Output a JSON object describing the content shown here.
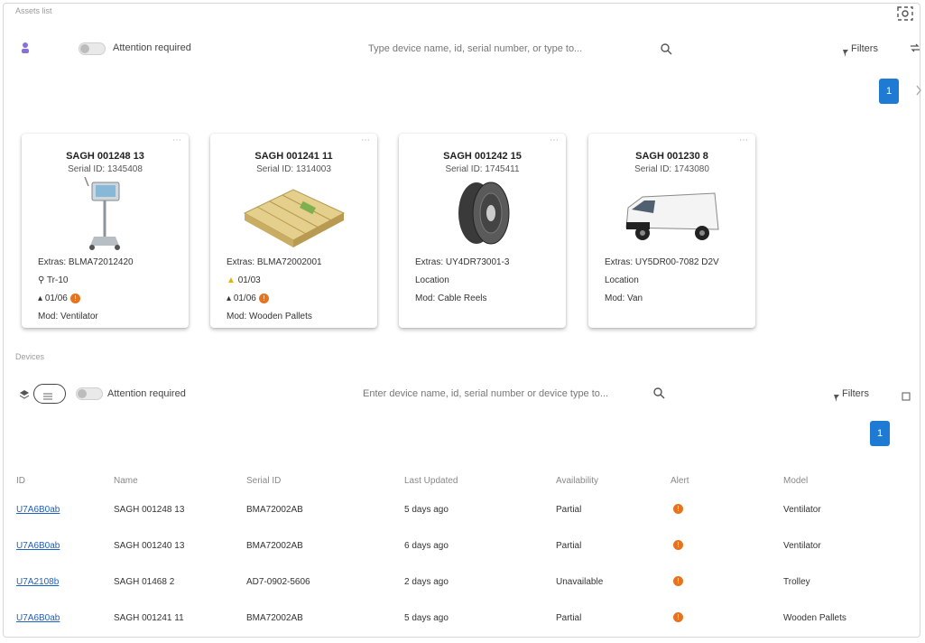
{
  "top": {
    "section_label": "Assets list",
    "attention_label": "Attention required",
    "search_placeholder": "Type device name, id, serial number, or type to...",
    "filters_label": "Filters",
    "page": "1"
  },
  "cards": [
    {
      "title": "SAGH 001248 13",
      "subtitle": "Serial ID: 1345408",
      "line1": "Extras: BLMA72012420",
      "line2": "Tr-10",
      "status_text": "01/06",
      "status_badge": "!",
      "line4": "Mod: Ventilator",
      "image": "ventilator"
    },
    {
      "title": "SAGH 001241 11",
      "subtitle": "Serial ID: 1314003",
      "line1": "Extras: BLMA72002001",
      "line2": "01/03",
      "status_text": "01/06",
      "status_badge": "!",
      "line4": "Mod: Wooden Pallets",
      "image": "pallet"
    },
    {
      "title": "SAGH 001242 15",
      "subtitle": "Serial ID: 1745411",
      "line1": "Extras: UY4DR73001-3",
      "line2": "Location",
      "status_text": "",
      "status_badge": "",
      "line4": "Mod: Cable Reels",
      "image": "cable-reel"
    },
    {
      "title": "SAGH 001230 8",
      "subtitle": "Serial ID: 1743080",
      "line1": "Extras: UY5DR00-7082 D2V",
      "line2": "Location",
      "status_text": "",
      "status_badge": "",
      "line4": "Mod: Van",
      "image": "van"
    }
  ],
  "bottom": {
    "section_label": "Devices",
    "attention_label": "Attention required",
    "search_placeholder": "Enter device name, id, serial number or device type to...",
    "filters_label": "Filters",
    "page": "1"
  },
  "table": {
    "headers": [
      "ID",
      "Name",
      "Serial ID",
      "Last Updated",
      "Availability",
      "Alert",
      "Model"
    ],
    "rows": [
      [
        "U7A6B0ab",
        "SAGH 001248 13",
        "BMA72002AB",
        "5 days ago",
        "Partial",
        "!",
        "Ventilator"
      ],
      [
        "U7A6B0ab",
        "SAGH 001240 13",
        "BMA72002AB",
        "6 days ago",
        "Partial",
        "!",
        "Ventilator"
      ],
      [
        "U7A2108b",
        "SAGH 01468 2",
        "AD7-0902-5606",
        "2 days ago",
        "Unavailable",
        "!",
        "Trolley"
      ],
      [
        "U7A6B0ab",
        "SAGH 001241 11",
        "BMA72002AB",
        "5 days ago",
        "Partial",
        "!",
        "Wooden Pallets"
      ]
    ]
  },
  "colors": {
    "accent": "#1f7ad3",
    "alert": "#e8731f",
    "link": "#1f5fbf"
  }
}
